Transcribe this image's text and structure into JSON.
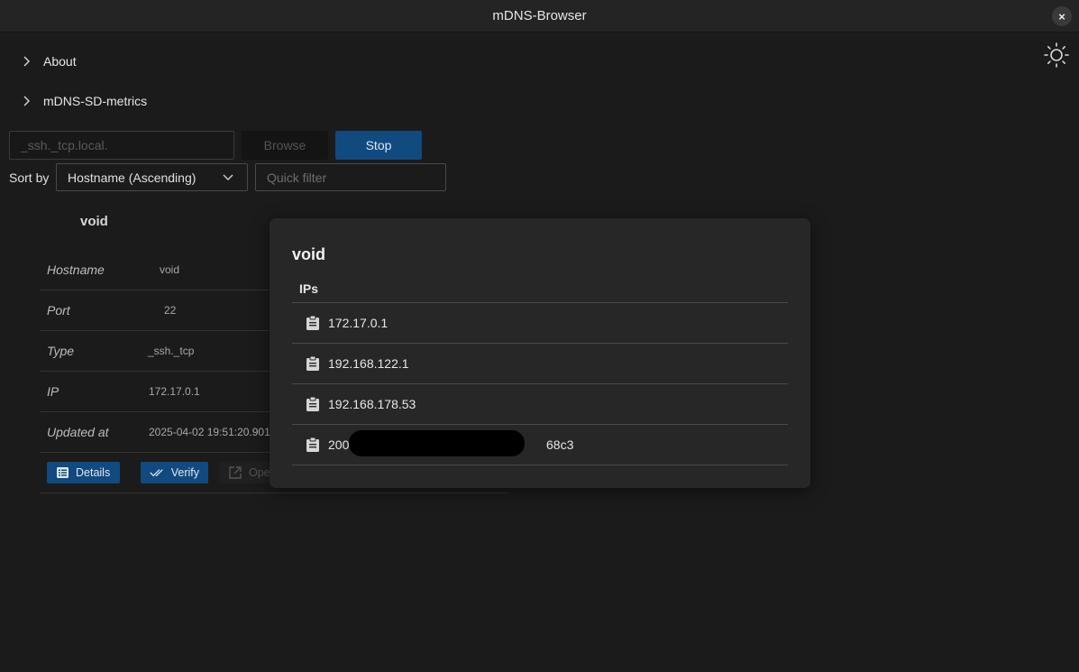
{
  "window": {
    "title": "mDNS-Browser",
    "close_label": "×"
  },
  "collapsibles": [
    {
      "label": "About"
    },
    {
      "label": "mDNS-SD-metrics"
    }
  ],
  "search": {
    "value": "_ssh._tcp.local.",
    "browse_label": "Browse",
    "stop_label": "Stop"
  },
  "sort": {
    "label": "Sort by",
    "selected": "Hostname (Ascending)"
  },
  "filter": {
    "placeholder": "Quick filter"
  },
  "card": {
    "title": "void",
    "rows": [
      {
        "key": "Hostname",
        "value": "void"
      },
      {
        "key": "Port",
        "value": "22"
      },
      {
        "key": "Type",
        "value": "_ssh._tcp"
      },
      {
        "key": "IP",
        "value": "172.17.0.1"
      },
      {
        "key": "Updated at",
        "value": "2025-04-02 19:51:20.901"
      }
    ],
    "actions": {
      "details": "Details",
      "verify": "Verify",
      "open": "Ope"
    }
  },
  "modal": {
    "title": "void",
    "column": "IPs",
    "ips": [
      "172.17.0.1",
      "192.168.122.1",
      "192.168.178.53",
      "200",
      "68c3"
    ]
  },
  "colors": {
    "accent": "#114a7e",
    "background": "#1b1b1b",
    "modal": "#272727"
  }
}
